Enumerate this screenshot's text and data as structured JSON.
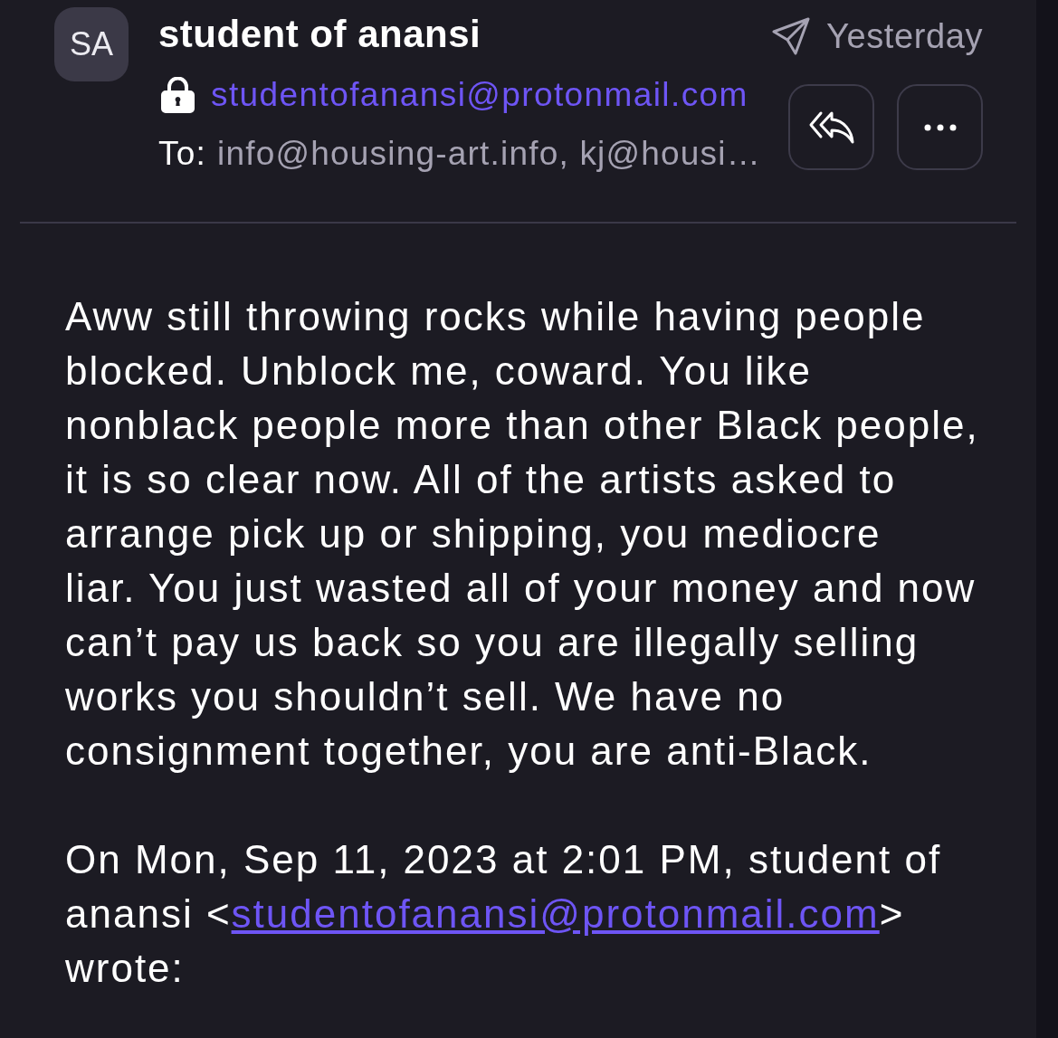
{
  "sender": {
    "initials": "SA",
    "name": "student of anansi",
    "email": "studentofanansi@protonmail.com"
  },
  "recipients": {
    "label": "To:",
    "value": "info@housing-art.info, kj@housi…"
  },
  "date": "Yesterday",
  "actions": [
    {
      "kind": "reply-all"
    },
    {
      "kind": "more"
    }
  ],
  "body": {
    "message": "Aww still throwing rocks while having people blocked. Unblock me, coward. You like nonblack people more than other Black people, it is so clear now. All of the artists asked to arrange pick up or shipping, you mediocre\nliar. You just wasted all of your money and now can’t pay us back so you are illegally selling works you shouldn’t sell. We have no consignment together, you are anti-Black.",
    "quote_attribution": {
      "prefix": "On Mon, Sep 11, 2023 at 2:01 PM, student of anansi <",
      "link": "studentofanansi@protonmail.com",
      "suffix": "> wrote:"
    }
  }
}
